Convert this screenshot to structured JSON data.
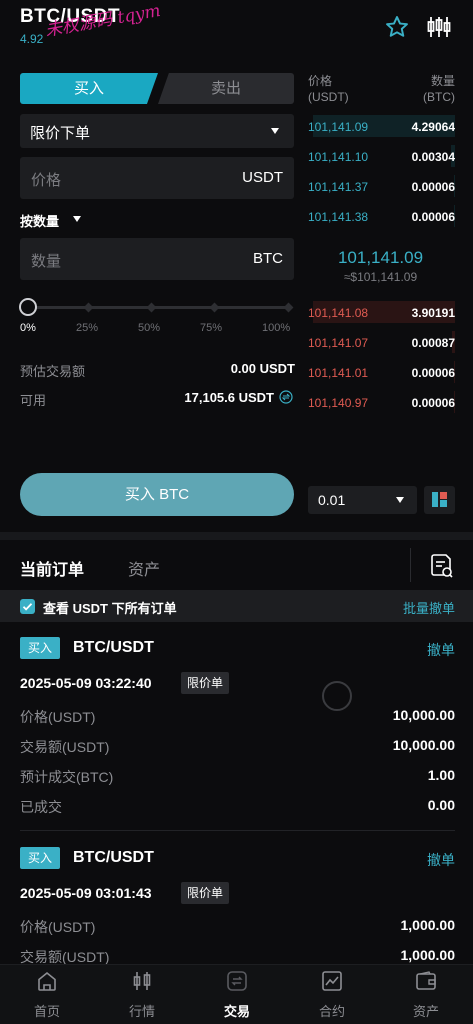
{
  "header": {
    "pair": "BTC/USDT",
    "change": "4.92",
    "watermark": "未权源码 tqym"
  },
  "form": {
    "tabs": {
      "buy": "买入",
      "sell": "卖出"
    },
    "order_type": "限价下单",
    "price_placeholder": "价格",
    "price_unit": "USDT",
    "qty_mode": "按数量",
    "qty_placeholder": "数量",
    "qty_unit": "BTC",
    "slider": {
      "value_pct": 0,
      "marks": [
        "0%",
        "25%",
        "50%",
        "75%",
        "100%"
      ]
    },
    "est_label": "预估交易额",
    "est_value": "0.00  USDT",
    "avail_label": "可用",
    "avail_value": "17,105.6  USDT",
    "submit": "买入 BTC"
  },
  "orderbook": {
    "head_price": "价格",
    "head_price_unit": "(USDT)",
    "head_qty": "数量",
    "head_qty_unit": "(BTC)",
    "asks": [
      {
        "price": "101,141.09",
        "qty": "4.29064",
        "depth": 0.95
      },
      {
        "price": "101,141.10",
        "qty": "0.00304",
        "depth": 0.03
      },
      {
        "price": "101,141.37",
        "qty": "0.00006",
        "depth": 0.01
      },
      {
        "price": "101,141.38",
        "qty": "0.00006",
        "depth": 0.01
      }
    ],
    "mid_price": "101,141.09",
    "mid_fiat": "≈$101,141.09",
    "bids": [
      {
        "price": "101,141.08",
        "qty": "3.90191",
        "depth": 0.95
      },
      {
        "price": "101,141.07",
        "qty": "0.00087",
        "depth": 0.02
      },
      {
        "price": "101,141.01",
        "qty": "0.00006",
        "depth": 0.01
      },
      {
        "price": "101,140.97",
        "qty": "0.00006",
        "depth": 0.01
      }
    ],
    "precision": "0.01"
  },
  "orders": {
    "tab_current": "当前订单",
    "tab_assets": "资产",
    "filter_label": "查看 USDT 下所有订单",
    "cancel_all": "批量撤单",
    "items": [
      {
        "side": "买入",
        "pair": "BTC/USDT",
        "cancel": "撤单",
        "time": "2025-05-09 03:22:40",
        "type": "限价单",
        "price_label": "价格(USDT)",
        "price": "10,000.00",
        "amount_label": "交易额(USDT)",
        "amount": "10,000.00",
        "est_label": "预计成交(BTC)",
        "est": "1.00",
        "filled_label": "已成交",
        "filled": "0.00"
      },
      {
        "side": "买入",
        "pair": "BTC/USDT",
        "cancel": "撤单",
        "time": "2025-05-09 03:01:43",
        "type": "限价单",
        "price_label": "价格(USDT)",
        "price": "1,000.00",
        "amount_label": "交易额(USDT)",
        "amount": "1,000.00"
      }
    ]
  },
  "nav": {
    "items": [
      "首页",
      "行情",
      "交易",
      "合约",
      "资产"
    ],
    "active_index": 2
  },
  "colors": {
    "accent": "#3ab0c6",
    "sell": "#e05b52",
    "buy_button": "#5fa6b4"
  }
}
